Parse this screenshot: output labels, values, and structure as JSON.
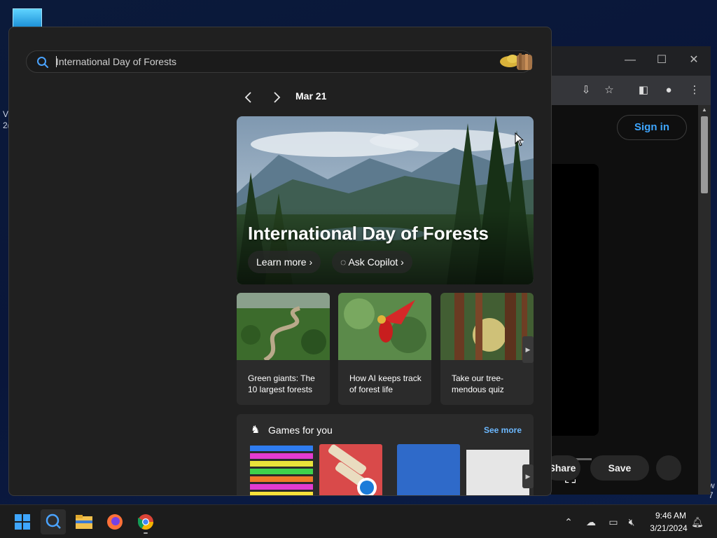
{
  "desktop": {
    "side_text_1": "V",
    "side_text_2": "2(",
    "right_edge_1": "w",
    "right_edge_2": "7"
  },
  "browser": {
    "minimize": "—",
    "maximize": "☐",
    "close": "✕",
    "sign_in": "Sign in",
    "share": "Share",
    "save": "Save"
  },
  "search": {
    "query": "International Day of Forests"
  },
  "nav": {
    "date": "Mar 21"
  },
  "hero": {
    "title": "International Day of Forests",
    "learn_more": "Learn more",
    "ask_copilot": "Ask Copilot"
  },
  "cards": [
    {
      "label": "Green giants: The 10 largest forests"
    },
    {
      "label": "How AI keeps track of forest life"
    },
    {
      "label": "Take our tree-mendous quiz"
    }
  ],
  "games": {
    "title": "Games for you",
    "see_more": "See more"
  },
  "taskbar": {
    "time": "9:46 AM",
    "date": "3/21/2024"
  },
  "colors": {
    "accent": "#6cb8ff",
    "flyout_bg": "#202020",
    "card_bg": "#2b2b2b"
  }
}
